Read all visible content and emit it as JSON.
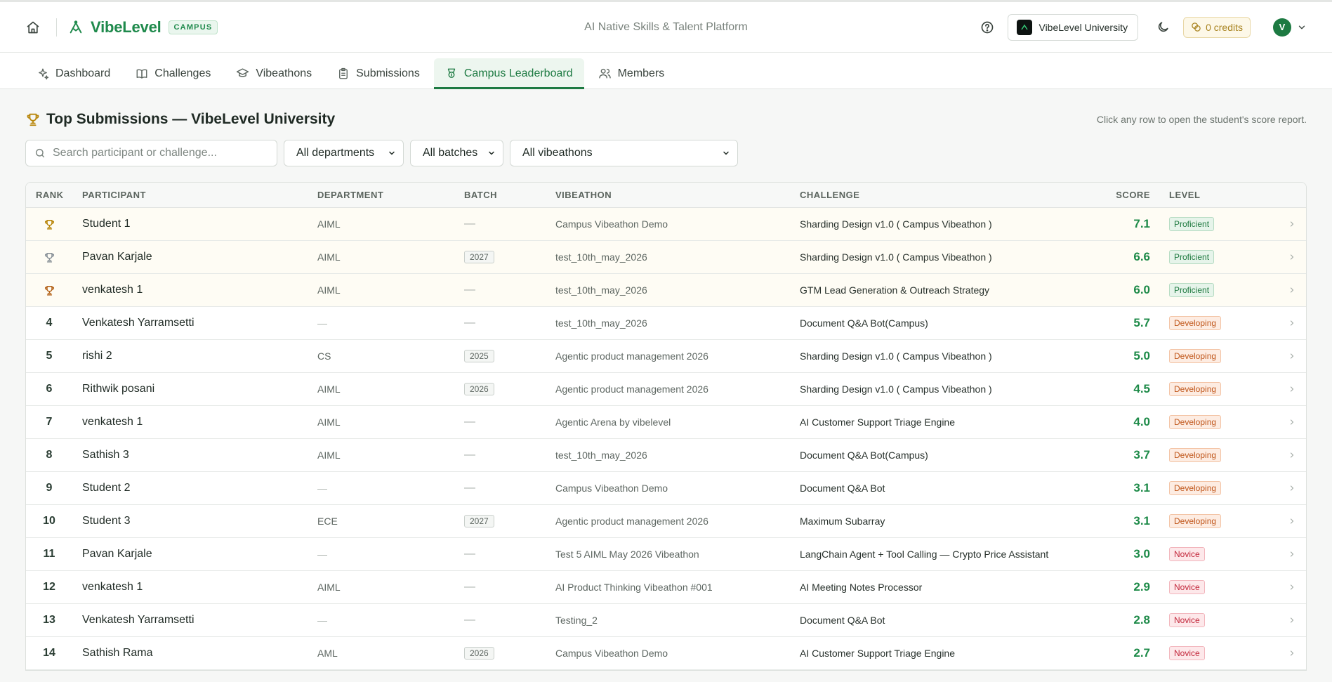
{
  "header": {
    "brand": "VibeLevel",
    "campus_badge": "CAMPUS",
    "tagline": "AI Native Skills & Talent Platform",
    "org_name": "VibeLevel University",
    "credits": "0 credits",
    "avatar_initial": "V"
  },
  "tabs": [
    {
      "label": "Dashboard",
      "icon": "sparkle-icon"
    },
    {
      "label": "Challenges",
      "icon": "book-icon"
    },
    {
      "label": "Vibeathons",
      "icon": "graduation-cap-icon"
    },
    {
      "label": "Submissions",
      "icon": "clipboard-icon"
    },
    {
      "label": "Campus Leaderboard",
      "icon": "award-icon",
      "active": true
    },
    {
      "label": "Members",
      "icon": "users-icon"
    }
  ],
  "page": {
    "title": "Top Submissions — VibeLevel University",
    "hint": "Click any row to open the student's score report."
  },
  "filters": {
    "search_placeholder": "Search participant or challenge...",
    "department": "All departments",
    "batch": "All batches",
    "vibeathon": "All vibeathons"
  },
  "table": {
    "columns": {
      "rank": "RANK",
      "participant": "PARTICIPANT",
      "department": "DEPARTMENT",
      "batch": "BATCH",
      "vibeathon": "VIBEATHON",
      "challenge": "CHALLENGE",
      "score": "SCORE",
      "level": "LEVEL"
    },
    "rows": [
      {
        "rank": "1",
        "trophy": "gold",
        "participant": "Student 1",
        "department": "AIML",
        "batch": "—",
        "vibeathon": "Campus Vibeathon Demo",
        "challenge": "Sharding Design v1.0 ( Campus Vibeathon )",
        "score": "7.1",
        "level": "Proficient"
      },
      {
        "rank": "2",
        "trophy": "silver",
        "participant": "Pavan Karjale",
        "department": "AIML",
        "batch": "2027",
        "vibeathon": "test_10th_may_2026",
        "challenge": "Sharding Design v1.0 ( Campus Vibeathon )",
        "score": "6.6",
        "level": "Proficient"
      },
      {
        "rank": "3",
        "trophy": "bronze",
        "participant": "venkatesh 1",
        "department": "AIML",
        "batch": "—",
        "vibeathon": "test_10th_may_2026",
        "challenge": "GTM Lead Generation & Outreach Strategy",
        "score": "6.0",
        "level": "Proficient"
      },
      {
        "rank": "4",
        "participant": "Venkatesh Yarramsetti",
        "department": "—",
        "batch": "—",
        "vibeathon": "test_10th_may_2026",
        "challenge": "Document Q&A Bot(Campus)",
        "score": "5.7",
        "level": "Developing"
      },
      {
        "rank": "5",
        "participant": "rishi 2",
        "department": "CS",
        "batch": "2025",
        "vibeathon": "Agentic product management 2026",
        "challenge": "Sharding Design v1.0 ( Campus Vibeathon )",
        "score": "5.0",
        "level": "Developing"
      },
      {
        "rank": "6",
        "participant": "Rithwik posani",
        "department": "AIML",
        "batch": "2026",
        "vibeathon": "Agentic product management 2026",
        "challenge": "Sharding Design v1.0 ( Campus Vibeathon )",
        "score": "4.5",
        "level": "Developing"
      },
      {
        "rank": "7",
        "participant": "venkatesh 1",
        "department": "AIML",
        "batch": "—",
        "vibeathon": "Agentic Arena by vibelevel",
        "challenge": "AI Customer Support Triage Engine",
        "score": "4.0",
        "level": "Developing"
      },
      {
        "rank": "8",
        "participant": "Sathish 3",
        "department": "AIML",
        "batch": "—",
        "vibeathon": "test_10th_may_2026",
        "challenge": "Document Q&A Bot(Campus)",
        "score": "3.7",
        "level": "Developing"
      },
      {
        "rank": "9",
        "participant": "Student 2",
        "department": "—",
        "batch": "—",
        "vibeathon": "Campus Vibeathon Demo",
        "challenge": "Document Q&A Bot",
        "score": "3.1",
        "level": "Developing"
      },
      {
        "rank": "10",
        "participant": "Student 3",
        "department": "ECE",
        "batch": "2027",
        "vibeathon": "Agentic product management 2026",
        "challenge": "Maximum Subarray",
        "score": "3.1",
        "level": "Developing"
      },
      {
        "rank": "11",
        "participant": "Pavan Karjale",
        "department": "—",
        "batch": "—",
        "vibeathon": "Test 5 AIML May 2026 Vibeathon",
        "challenge": "LangChain Agent + Tool Calling — Crypto Price Assistant",
        "score": "3.0",
        "level": "Novice"
      },
      {
        "rank": "12",
        "participant": "venkatesh 1",
        "department": "AIML",
        "batch": "—",
        "vibeathon": "AI Product Thinking Vibeathon #001",
        "challenge": "AI Meeting Notes Processor",
        "score": "2.9",
        "level": "Novice"
      },
      {
        "rank": "13",
        "participant": "Venkatesh Yarramsetti",
        "department": "—",
        "batch": "—",
        "vibeathon": "Testing_2",
        "challenge": "Document Q&A Bot",
        "score": "2.8",
        "level": "Novice"
      },
      {
        "rank": "14",
        "participant": "Sathish Rama",
        "department": "AML",
        "batch": "2026",
        "vibeathon": "Campus Vibeathon Demo",
        "challenge": "AI Customer Support Triage Engine",
        "score": "2.7",
        "level": "Novice"
      }
    ]
  },
  "colors": {
    "brand": "#1f8a4c",
    "gold": "#b8860b",
    "silver": "#8a9299",
    "bronze": "#b5651d"
  }
}
